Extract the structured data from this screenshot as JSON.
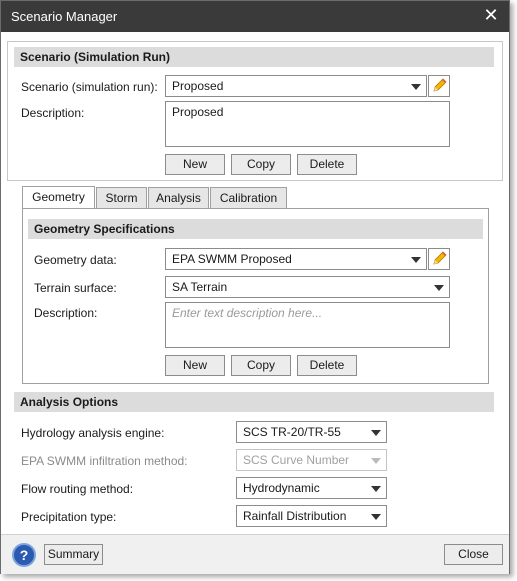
{
  "window": {
    "title": "Scenario Manager",
    "close_glyph": "✕"
  },
  "scenario": {
    "header": "Scenario (Simulation Run)",
    "scenario_label": "Scenario (simulation run):",
    "scenario_value": "Proposed",
    "description_label": "Description:",
    "description_value": "Proposed",
    "new_label": "New",
    "copy_label": "Copy",
    "delete_label": "Delete"
  },
  "tabs": [
    {
      "label": "Geometry",
      "active": true
    },
    {
      "label": "Storm"
    },
    {
      "label": "Analysis"
    },
    {
      "label": "Calibration"
    }
  ],
  "geometry": {
    "header": "Geometry Specifications",
    "geometry_label": "Geometry data:",
    "geometry_value": "EPA SWMM Proposed",
    "terrain_label": "Terrain surface:",
    "terrain_value": "SA Terrain",
    "description_label": "Description:",
    "description_placeholder": "Enter text description here...",
    "new_label": "New",
    "copy_label": "Copy",
    "delete_label": "Delete"
  },
  "analysis_options": {
    "header": "Analysis Options",
    "hydrology_label": "Hydrology analysis engine:",
    "hydrology_value": "SCS TR-20/TR-55",
    "infiltration_label": "EPA SWMM infiltration method:",
    "infiltration_value": "SCS Curve Number",
    "routing_label": "Flow routing method:",
    "routing_value": "Hydrodynamic",
    "precip_label": "Precipitation type:",
    "precip_value": "Rainfall Distribution"
  },
  "footer": {
    "help_glyph": "?",
    "summary_label": "Summary",
    "close_label": "Close"
  },
  "colors": {
    "titlebar": "#3a3a3a",
    "section_header": "#dcdcdc",
    "help_icon": "#2a5bb0",
    "pencil": "#f2b705"
  }
}
